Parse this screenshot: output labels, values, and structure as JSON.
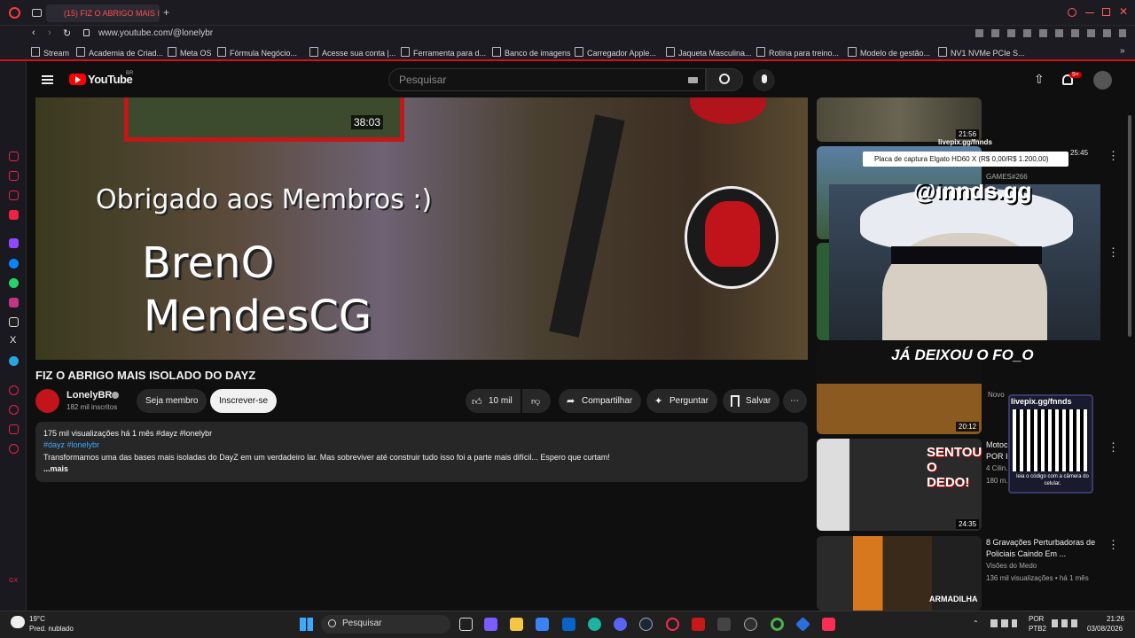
{
  "browser": {
    "tab_title": "(15) FIZ O ABRIGO MAIS IS",
    "url": "www.youtube.com/@lonelybr",
    "bookmarks": [
      "Stream",
      "Academia de Criad...",
      "Meta OS",
      "Fórmula Negócio...",
      "Acesse sua conta |...",
      "Ferramenta para d...",
      "Banco de imagens",
      "Carregador Apple...",
      "Jaqueta Masculina...",
      "Rotina para treino...",
      "Modelo de gestão...",
      "NV1 NVMe PCIe S..."
    ]
  },
  "youtube": {
    "logo": "YouTube",
    "logo_region": "BR",
    "search_placeholder": "Pesquisar",
    "notif_count": "9+"
  },
  "player": {
    "top_thumb_duration": "38:03",
    "thanks_text": "Obrigado aos Membros :)",
    "name_line1": "BrenO",
    "name_line2": "MendesCG"
  },
  "video": {
    "title": "FIZ O ABRIGO MAIS ISOLADO DO DAYZ",
    "channel": "LonelyBR",
    "subscribers": "182 mil inscritos",
    "join_label": "Seja membro",
    "subscribe_label": "Inscrever-se",
    "likes": "10 mil",
    "share_label": "Compartilhar",
    "ask_label": "Perguntar",
    "save_label": "Salvar"
  },
  "description": {
    "meta": "175 mil visualizações  há 1 mês  #dayz #lonelybr",
    "tags": "#dayz #lonelybr",
    "text": "Transformamos uma das bases mais isoladas do DayZ em um verdadeiro lar. Mas sobreviver até construir tudo isso foi a parte mais difícil... Espero que curtam!",
    "more": "...mais"
  },
  "recommendations": [
    {
      "duration": "21:56"
    },
    {
      "badge": "25:45",
      "channel": "GAMES#266"
    },
    {
      "duration": "20:12",
      "label": "Novo",
      "thumb_text": "JÁ DEIXOU O FO_O"
    },
    {
      "duration": "24:35",
      "title": "Motoc...",
      "title2": "POR I...",
      "channel": "4 Cilin...",
      "views": "180 m...",
      "thumb_text": "SENTOU O DEDO!"
    },
    {
      "title": "8 Gravações Perturbadoras de",
      "title2": "Policiais Caindo Em ...",
      "channel": "Visões do Medo",
      "views": "136 mil visualizações  •  há 1 mês",
      "thumb_text": "ARMADILHA"
    }
  ],
  "stream_overlay": {
    "tooltip": "Placa de captura Elgato HD60 X (R$ 0,00/R$ 1.200,00)",
    "livepix_top": "livepix.gg/fnnds",
    "handle": "@innds.gg",
    "qr_title": "livepix.gg/fnnds",
    "qr_caption": "leia o código com a câmera do celular."
  },
  "taskbar": {
    "weather_temp": "19°C",
    "weather_desc": "Pred. nublado",
    "search": "Pesquisar",
    "lang1": "POR",
    "lang2": "PTB2",
    "time": "21:26",
    "date": "03/08/2026"
  }
}
